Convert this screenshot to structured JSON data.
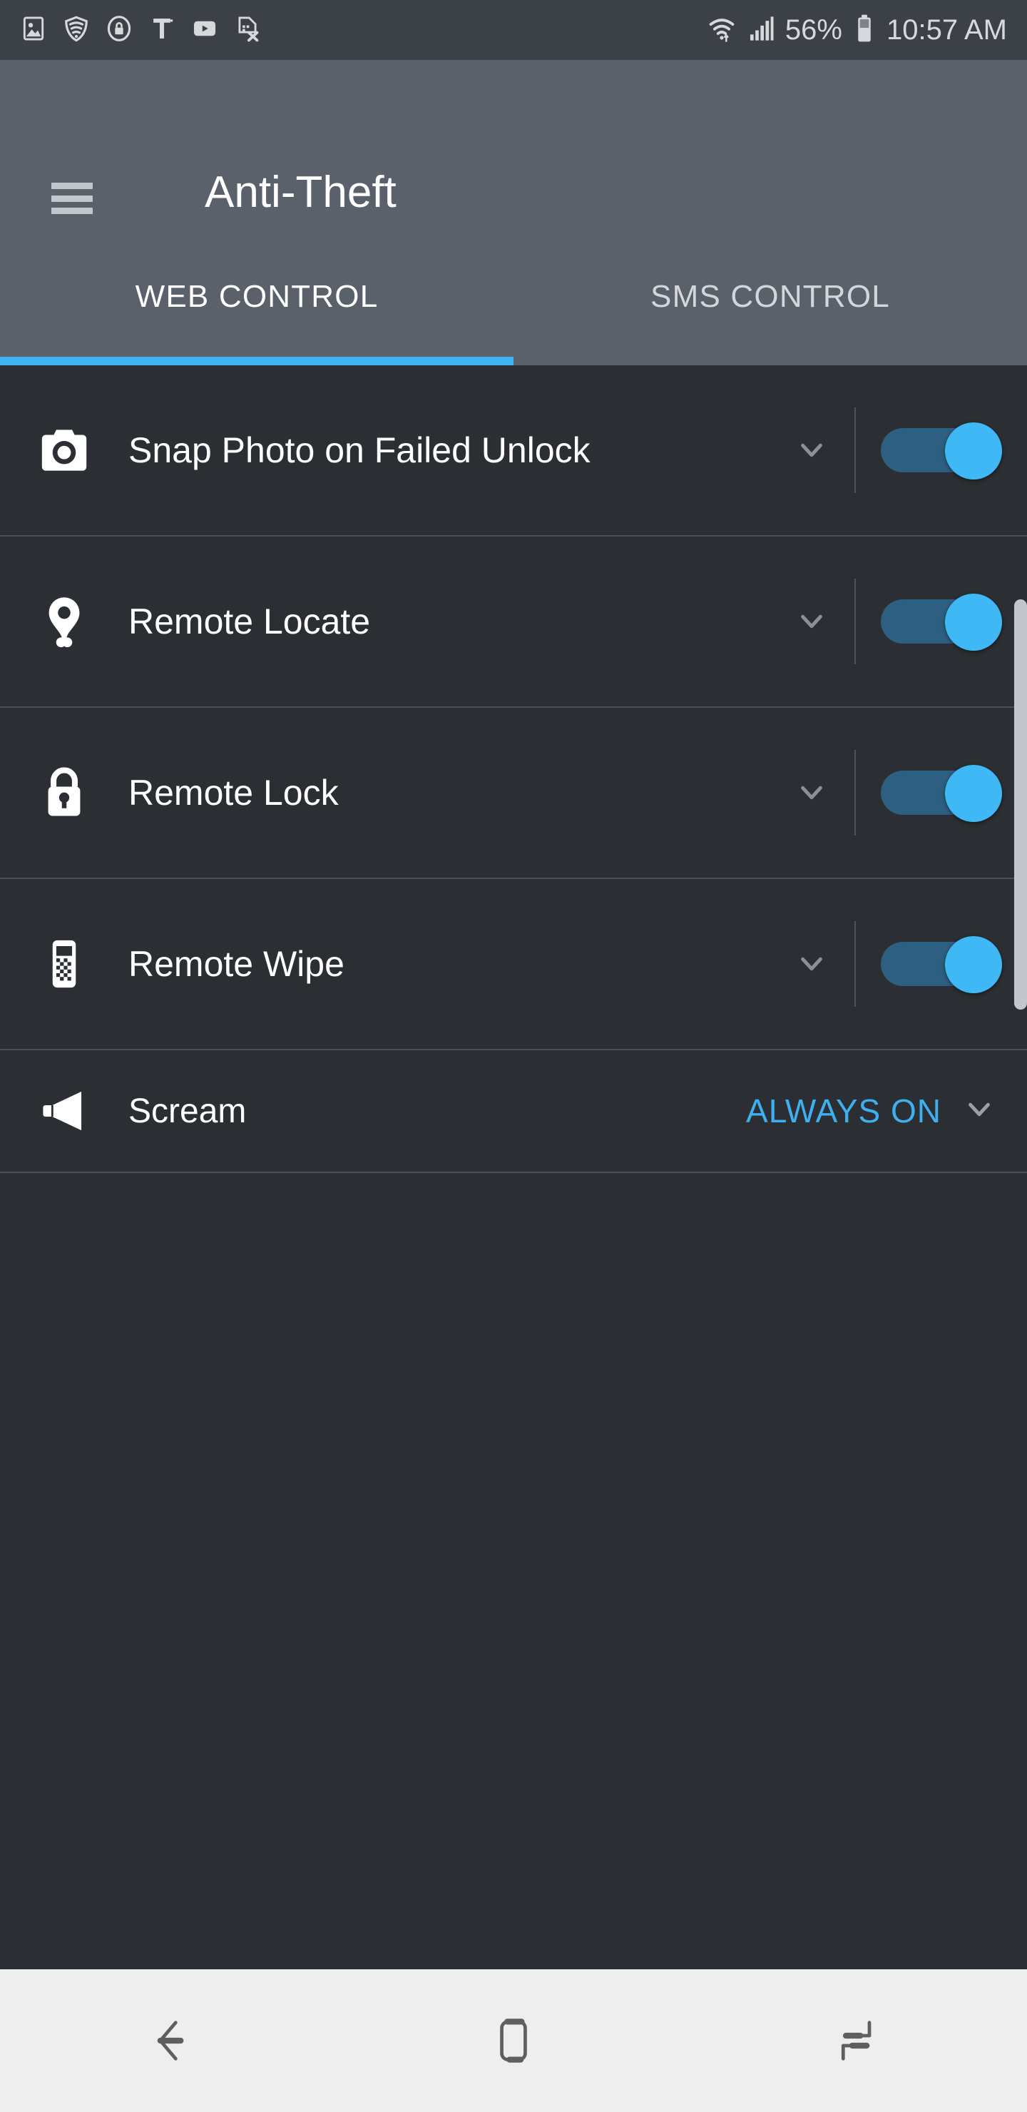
{
  "status_bar": {
    "left_icons": [
      {
        "name": "image-icon",
        "label": "Screenshot"
      },
      {
        "name": "vpn-shield-icon",
        "label": "Secure Wi-Fi"
      },
      {
        "name": "lock-circle-icon",
        "label": "Secure Folder"
      },
      {
        "name": "t-mobile-icon",
        "label": "T-Mobile"
      },
      {
        "name": "youtube-icon",
        "label": "YouTube"
      },
      {
        "name": "sim-card-error-icon",
        "label": "No SIM"
      }
    ],
    "wifi_label": "Wi-Fi",
    "signal_label": "Signal",
    "battery_percent": "56%",
    "time": "10:57 AM"
  },
  "app_bar": {
    "menu_label": "Menu",
    "title": "Anti-Theft"
  },
  "tabs": {
    "items": [
      {
        "label": "WEB CONTROL",
        "active": true
      },
      {
        "label": "SMS CONTROL",
        "active": false
      }
    ],
    "indicator_color": "#40b4f0"
  },
  "features": [
    {
      "id": "snap-photo-on-failed-unlock",
      "label": "Snap Photo on Failed Unlock",
      "icon": "camera-icon",
      "control": "toggle",
      "toggle_on": true,
      "expandable": true
    },
    {
      "id": "remote-locate",
      "label": "Remote Locate",
      "icon": "map-pin-icon",
      "control": "toggle",
      "toggle_on": true,
      "expandable": true
    },
    {
      "id": "remote-lock",
      "label": "Remote Lock",
      "icon": "padlock-icon",
      "control": "toggle",
      "toggle_on": true,
      "expandable": true
    },
    {
      "id": "remote-wipe",
      "label": "Remote Wipe",
      "icon": "phone-wipe-icon",
      "control": "toggle",
      "toggle_on": true,
      "expandable": true
    },
    {
      "id": "scream",
      "label": "Scream",
      "icon": "megaphone-icon",
      "control": "status",
      "status_value": "ALWAYS ON",
      "expandable": true
    }
  ],
  "colors": {
    "accent": "#3fb8f5",
    "toggle_track": "#2d5f80",
    "status_text": "#3fb0ef",
    "app_bar_bg": "#5b616b",
    "content_bg": "#2b2e33",
    "status_bar_bg": "#3c4148",
    "nav_bar_bg": "#eeeeee"
  },
  "nav_bar": {
    "buttons": [
      {
        "name": "back-button",
        "label": "Back"
      },
      {
        "name": "home-button",
        "label": "Home"
      },
      {
        "name": "recents-button",
        "label": "Recents"
      }
    ]
  },
  "scrollbar": {
    "visible": true
  }
}
